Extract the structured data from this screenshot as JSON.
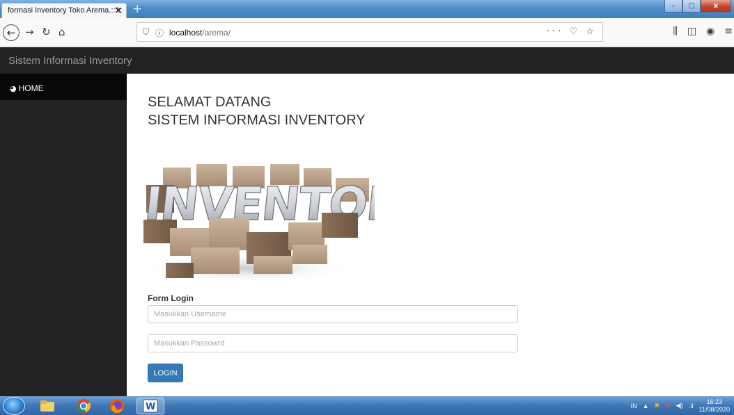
{
  "browser": {
    "tab_title": "formasi Inventory Toko Arema.::\"::",
    "tab_close": "✕",
    "new_tab": "+",
    "url_host": "localhost",
    "url_path": "/arema/",
    "window_controls": {
      "minimize": "–",
      "maximize": "□",
      "close": "x"
    }
  },
  "app": {
    "brand": "Sistem Informasi Inventory",
    "sidebar": {
      "items": [
        {
          "label": "HOME",
          "icon": "dashboard-icon"
        }
      ]
    },
    "welcome_line1": "SELAMAT DATANG",
    "welcome_line2": "SISTEM INFORMASI INVENTORY",
    "image_word": "INVENTORY",
    "form": {
      "title": "Form Login",
      "username_placeholder": "Masukkan Username",
      "password_placeholder": "Masukkan Passowrd",
      "login_label": "LOGIN"
    }
  },
  "taskbar": {
    "language": "IN",
    "time": "16:23",
    "date": "11/08/2020"
  },
  "colors": {
    "header_bg": "#222222",
    "sidebar_active": "#080808",
    "button_primary": "#337ab7"
  }
}
